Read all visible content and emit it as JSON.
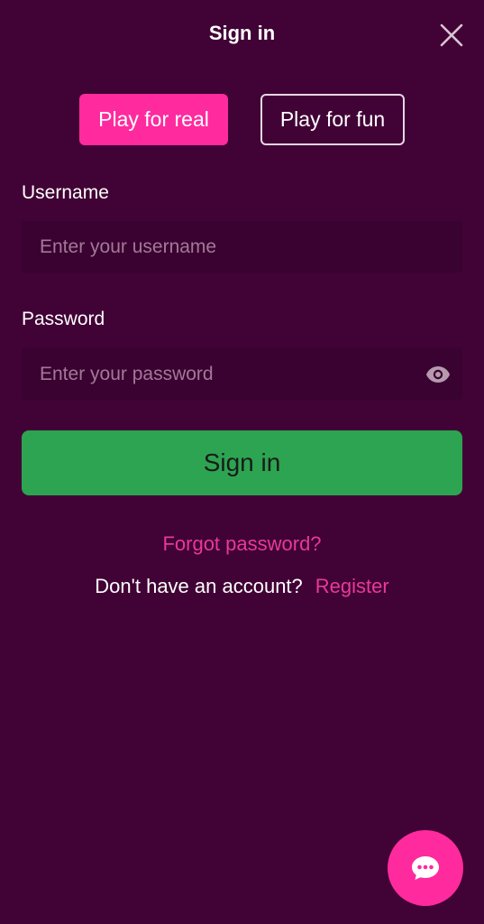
{
  "header": {
    "title": "Sign in"
  },
  "mode_toggle": {
    "real_label": "Play for real",
    "fun_label": "Play for fun",
    "selected": "real"
  },
  "form": {
    "username": {
      "label": "Username",
      "placeholder": "Enter your username",
      "value": ""
    },
    "password": {
      "label": "Password",
      "placeholder": "Enter your password",
      "value": "",
      "toggle_icon": "eye-icon"
    },
    "submit_label": "Sign in"
  },
  "links": {
    "forgot_password": "Forgot password?",
    "no_account_text": "Don't have an account?",
    "register": "Register"
  },
  "icons": {
    "close": "close-icon",
    "chat": "chat-bubble-icon"
  },
  "colors": {
    "background": "#410235",
    "field_background": "#3a0230",
    "accent_pink": "#ff2a9e",
    "link_pink": "#e8399a",
    "signin_green": "#2da451",
    "placeholder": "#a3789a"
  }
}
